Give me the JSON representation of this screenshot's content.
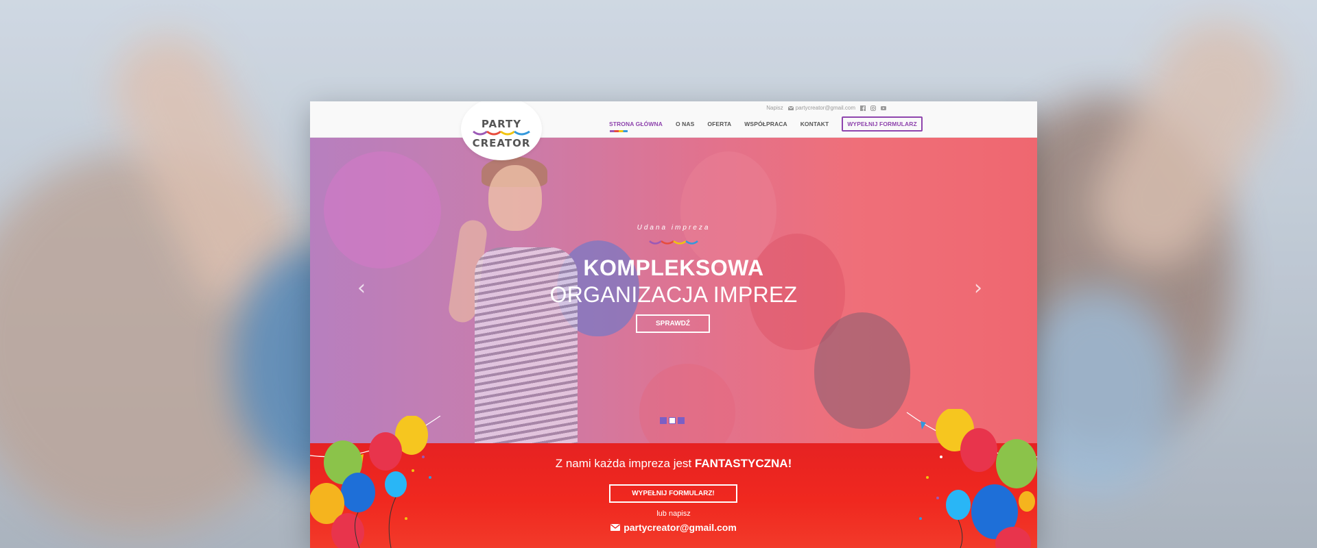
{
  "topbar": {
    "write_label": "Napisz",
    "email": "partycreator@gmail.com",
    "social_icons": [
      "facebook-icon",
      "instagram-icon",
      "youtube-icon"
    ]
  },
  "logo": {
    "line1": "PARTY",
    "line2": "CREATOR"
  },
  "nav": {
    "items": [
      {
        "label": "STRONA GŁÓWNA",
        "active": true
      },
      {
        "label": "O NAS"
      },
      {
        "label": "OFERTA"
      },
      {
        "label": "WSPÓŁPRACA"
      },
      {
        "label": "KONTAKT"
      }
    ],
    "form_button": "WYPEŁNIJ FORMULARZ"
  },
  "hero": {
    "eyebrow": "Udana impreza",
    "title_bold": "KOMPLEKSOWA",
    "title_light": "ORGANIZACJA IMPREZ",
    "button": "SPRAWDŹ",
    "slides": 3,
    "active_slide": 1
  },
  "cta": {
    "title_prefix": "Z nami każda impreza jest ",
    "title_bold": "FANTASTYCZNA!",
    "button": "WYPEŁNIJ FORMULARZ!",
    "or_label": "lub napisz",
    "email": "partycreator@gmail.com"
  },
  "colors": {
    "accent_purple": "#8e44ad",
    "cta_red": "#ec2420",
    "hero_left": "#b77fbf",
    "hero_right": "#ef6770"
  }
}
